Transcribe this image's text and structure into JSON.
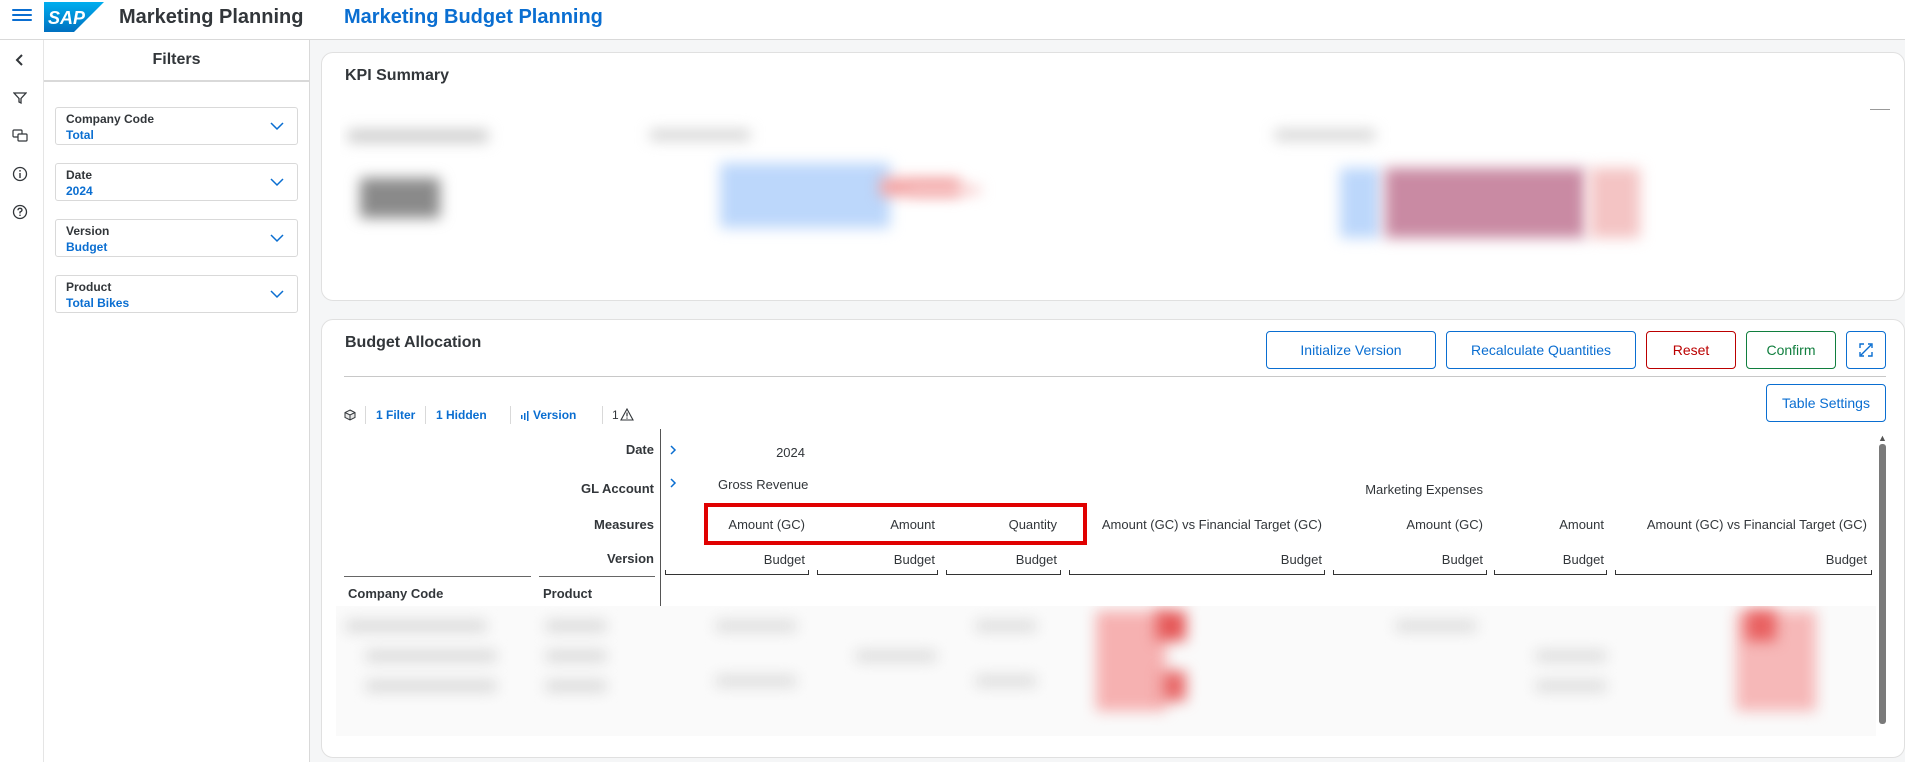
{
  "shell": {
    "app_title": "Marketing Planning",
    "page_title": "Marketing Budget Planning",
    "logo_text": "SAP"
  },
  "filters": {
    "title": "Filters",
    "items": [
      {
        "label": "Company Code",
        "value": "Total"
      },
      {
        "label": "Date",
        "value": "2024"
      },
      {
        "label": "Version",
        "value": "Budget"
      },
      {
        "label": "Product",
        "value": "Total Bikes"
      }
    ]
  },
  "kpi": {
    "title": "KPI Summary"
  },
  "budget": {
    "title": "Budget Allocation",
    "buttons": {
      "initialize": "Initialize Version",
      "recalculate": "Recalculate Quantities",
      "reset": "Reset",
      "confirm": "Confirm",
      "table_settings": "Table Settings"
    },
    "toolbar": {
      "filter": "1 Filter",
      "hidden": "1 Hidden",
      "version": "Version",
      "warnings": "1"
    },
    "row_headers": {
      "date": "Date",
      "gl_account": "GL Account",
      "measures": "Measures",
      "version": "Version",
      "company_code": "Company Code",
      "product": "Product"
    },
    "date_value": "2024",
    "gl_accounts": [
      "Gross Revenue",
      "Marketing Expenses"
    ],
    "measures": [
      "Amount (GC)",
      "Amount",
      "Quantity",
      "Amount (GC) vs Financial Target (GC)",
      "Amount (GC)",
      "Amount",
      "Amount (GC) vs Financial Target (GC)"
    ],
    "versions": [
      "Budget",
      "Budget",
      "Budget",
      "Budget",
      "Budget",
      "Budget",
      "Budget"
    ]
  },
  "colors": {
    "accent": "#0a6ed1",
    "highlight": "#e00000",
    "reset": "#bb0000",
    "confirm": "#107e3e"
  }
}
